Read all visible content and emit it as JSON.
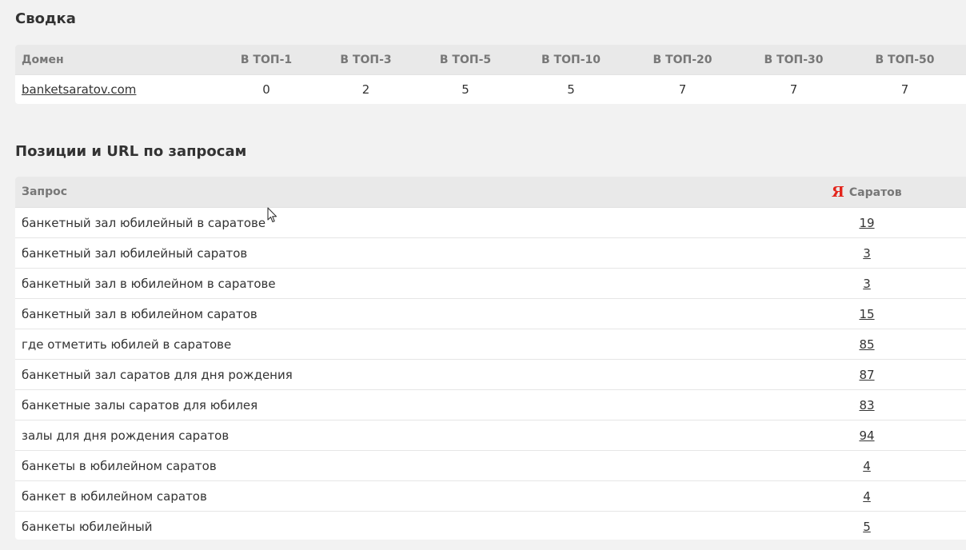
{
  "summary": {
    "title": "Сводка",
    "headers": [
      "Домен",
      "В ТОП-1",
      "В ТОП-3",
      "В ТОП-5",
      "В ТОП-10",
      "В ТОП-20",
      "В ТОП-30",
      "В ТОП-50"
    ],
    "row": {
      "domain": "banketsaratov.com",
      "values": [
        "0",
        "2",
        "5",
        "5",
        "7",
        "7",
        "7"
      ]
    }
  },
  "positions": {
    "title": "Позиции и URL по запросам",
    "header_query": "Запрос",
    "header_region": "Саратов",
    "search_engine_icon": "yandex-icon",
    "search_engine_glyph": "Я",
    "accent_color": "#e3251c",
    "rows": [
      {
        "query": "банкетный зал юбилейный в саратове",
        "position": "19"
      },
      {
        "query": "банкетный зал юбилейный саратов",
        "position": "3"
      },
      {
        "query": "банкетный зал в юбилейном в саратове",
        "position": "3"
      },
      {
        "query": "банкетный зал в юбилейном саратов",
        "position": "15"
      },
      {
        "query": "где отметить юбилей в саратове",
        "position": "85"
      },
      {
        "query": "банкетный зал саратов для дня рождения",
        "position": "87"
      },
      {
        "query": "банкетные залы саратов для юбилея",
        "position": "83"
      },
      {
        "query": "залы для дня рождения саратов",
        "position": "94"
      },
      {
        "query": "банкеты в юбилейном саратов",
        "position": "4"
      },
      {
        "query": "банкет в юбилейном саратов",
        "position": "4"
      },
      {
        "query": "банкеты юбилейный",
        "position": "5"
      }
    ]
  }
}
